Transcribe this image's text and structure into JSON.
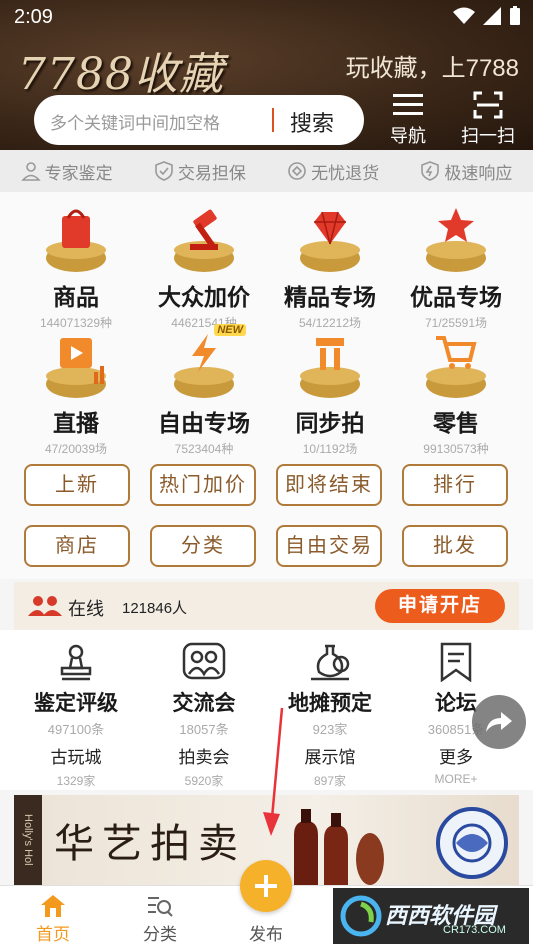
{
  "status_bar": {
    "time": "2:09"
  },
  "header": {
    "brand": "7788收藏",
    "slogan": "玩收藏，上7788",
    "search_placeholder": "多个关键词中间加空格",
    "search_button": "搜索",
    "nav_label": "导航",
    "scan_label": "扫一扫"
  },
  "assurances": [
    "专家鉴定",
    "交易担保",
    "无忧退货",
    "极速响应"
  ],
  "categories": [
    {
      "title": "商品",
      "count": "144071329种",
      "icon": "shopping-bag-icon"
    },
    {
      "title": "大众加价",
      "count": "44621541种",
      "icon": "auction-hammer-icon"
    },
    {
      "title": "精品专场",
      "count": "54/12212场",
      "icon": "diamond-icon"
    },
    {
      "title": "优品专场",
      "count": "71/25591场",
      "icon": "star-icon"
    },
    {
      "title": "直播",
      "count": "47/20039场",
      "icon": "live-video-icon"
    },
    {
      "title": "自由专场",
      "count": "7523404种",
      "icon": "lightning-icon",
      "badge": "NEW"
    },
    {
      "title": "同步拍",
      "count": "10/1192场",
      "icon": "sync-auction-icon"
    },
    {
      "title": "零售",
      "count": "99130573种",
      "icon": "cart-icon"
    }
  ],
  "tag_buttons": [
    "上新",
    "热门加价",
    "即将结束",
    "排行",
    "商店",
    "分类",
    "自由交易",
    "批发"
  ],
  "online": {
    "label": "在线",
    "count": "121846人",
    "apply_button": "申请开店"
  },
  "services": [
    {
      "title": "鉴定评级",
      "count": "497100条",
      "icon": "stamp-icon"
    },
    {
      "title": "交流会",
      "count": "18057条",
      "icon": "people-icon"
    },
    {
      "title": "地摊预定",
      "count": "923家",
      "icon": "vase-icon"
    },
    {
      "title": "论坛",
      "count": "360851条",
      "icon": "bookmark-icon"
    }
  ],
  "services2": [
    {
      "title": "古玩城",
      "count": "1329家"
    },
    {
      "title": "拍卖会",
      "count": "5920家"
    },
    {
      "title": "展示馆",
      "count": "897家"
    },
    {
      "title": "更多",
      "count": "MORE+"
    }
  ],
  "banner": {
    "title": "华艺拍卖",
    "side_text": "Holly's Hol"
  },
  "bottom_nav": {
    "home": "首页",
    "category": "分类",
    "publish": "发布"
  },
  "watermark": {
    "text": "西西软件园",
    "sub": "CR173.COM"
  },
  "colors": {
    "accent": "#ec5c1c",
    "brown": "#8b5a2b",
    "gold": "#f6b12b",
    "header_bg": "#3b2718"
  }
}
